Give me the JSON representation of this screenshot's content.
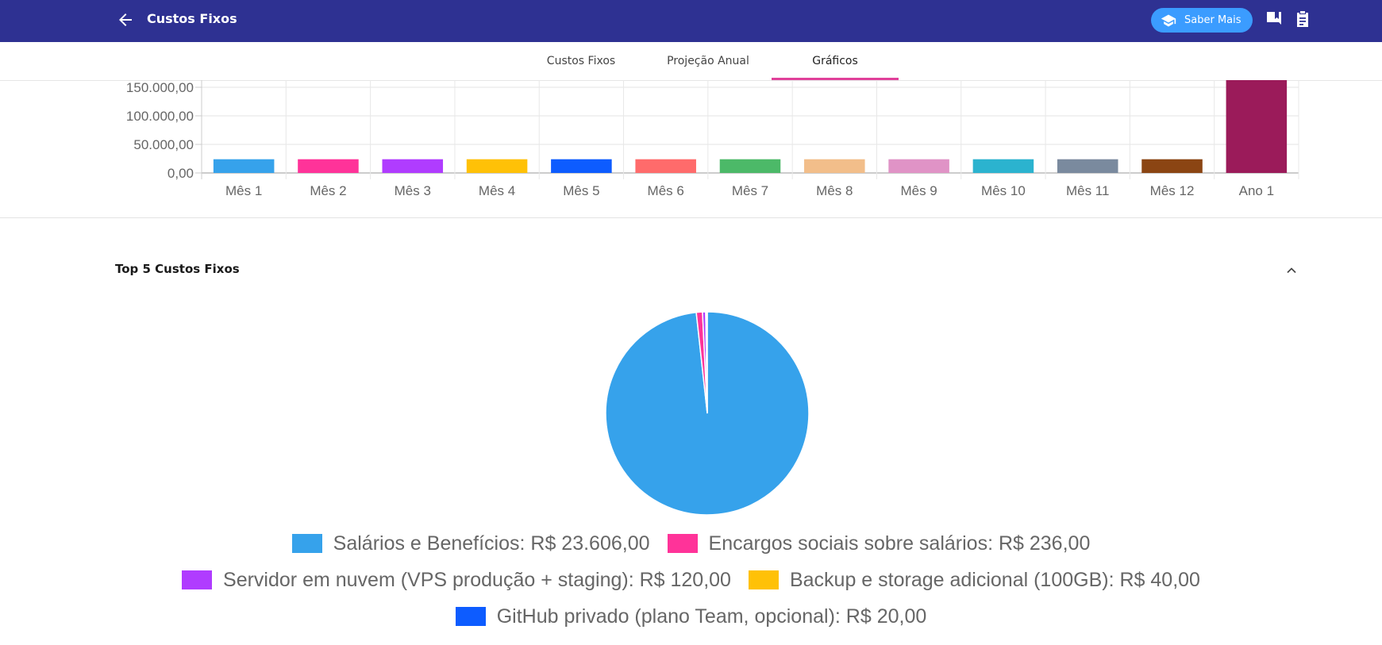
{
  "header": {
    "title": "Custos Fixos",
    "saber_mais": "Saber Mais"
  },
  "tabs": [
    {
      "label": "Custos Fixos"
    },
    {
      "label": "Projeção Anual"
    },
    {
      "label": "Gráficos"
    }
  ],
  "active_tab": "Gráficos",
  "top5": {
    "title": "Top 5 Custos Fixos"
  },
  "chart_data": [
    {
      "type": "bar",
      "categories": [
        "Mês 1",
        "Mês 2",
        "Mês 3",
        "Mês 4",
        "Mês 5",
        "Mês 6",
        "Mês 7",
        "Mês 8",
        "Mês 9",
        "Mês 10",
        "Mês 11",
        "Mês 12",
        "Ano 1"
      ],
      "values": [
        24022,
        24022,
        24022,
        24022,
        24022,
        24022,
        24022,
        24022,
        24022,
        24022,
        24022,
        24022,
        288264
      ],
      "colors": [
        "#36a2eb",
        "#ff3399",
        "#b03cff",
        "#ffc107",
        "#0d5cff",
        "#ff6b6b",
        "#4cb968",
        "#f2be8a",
        "#e093c6",
        "#2bb3cf",
        "#7a8a9e",
        "#8b4513",
        "#9b1b5a"
      ],
      "y_ticks": [
        "0,00",
        "50.000,00",
        "100.000,00",
        "150.000,00"
      ],
      "y_tick_values": [
        0,
        50000,
        100000,
        150000
      ],
      "grid": true
    },
    {
      "type": "pie",
      "labels": [
        "Salários e Benefícios: R$ 23.606,00",
        "Encargos sociais sobre salários: R$ 236,00",
        "Servidor em nuvem (VPS produção + staging): R$ 120,00",
        "Backup e storage adicional (100GB): R$ 40,00",
        "GitHub privado (plano Team, opcional): R$ 20,00"
      ],
      "values": [
        23606,
        236,
        120,
        40,
        20
      ],
      "colors": [
        "#36a2eb",
        "#ff3399",
        "#b03cff",
        "#ffc107",
        "#0d5cff"
      ],
      "legend": "bottom"
    }
  ]
}
